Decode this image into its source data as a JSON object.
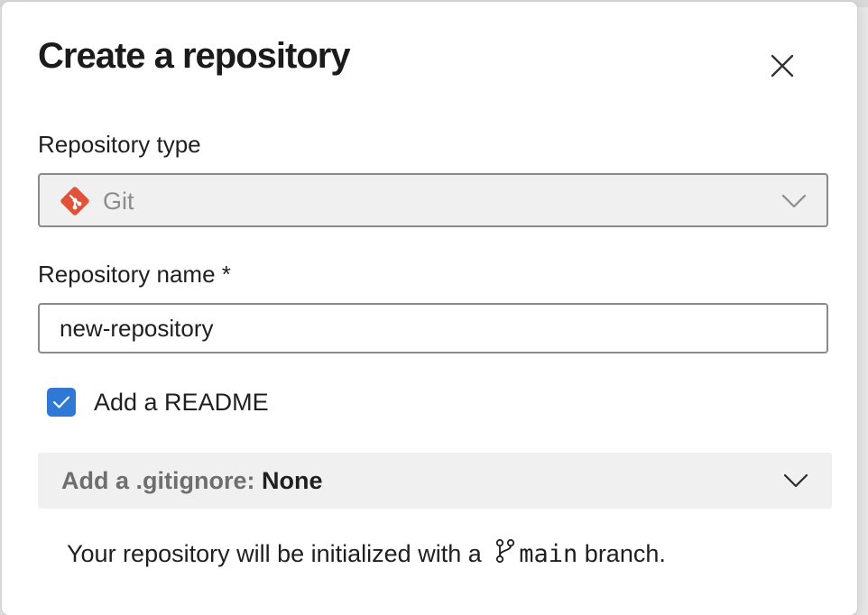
{
  "dialog": {
    "title": "Create a repository",
    "close_icon": "close-icon"
  },
  "repo_type": {
    "label": "Repository type",
    "value": "Git",
    "icon": "git-logo-icon",
    "disabled": true
  },
  "repo_name": {
    "label": "Repository name *",
    "value": "new-repository"
  },
  "readme": {
    "label": "Add a README",
    "checked": true
  },
  "gitignore": {
    "prefix": "Add a .gitignore:",
    "value": "None"
  },
  "info": {
    "before": "Your repository will be initialized with a",
    "branch_icon": "branch-icon",
    "branch": "main",
    "after": "branch."
  },
  "colors": {
    "accent": "#2f78d4",
    "git_logo": "#e0533a"
  }
}
